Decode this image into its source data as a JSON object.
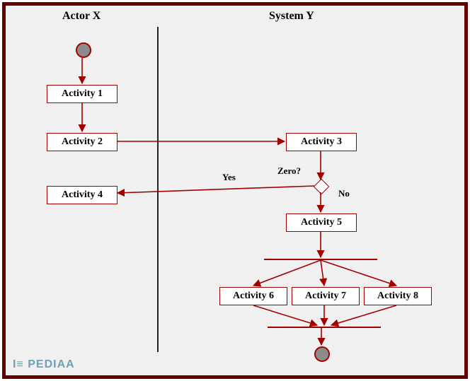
{
  "lanes": {
    "actor": "Actor X",
    "system": "System Y"
  },
  "activities": {
    "a1": "Activity 1",
    "a2": "Activity 2",
    "a3": "Activity 3",
    "a4": "Activity 4",
    "a5": "Activity 5",
    "a6": "Activity 6",
    "a7": "Activity 7",
    "a8": "Activity 8"
  },
  "decision": {
    "question": "Zero?",
    "yes": "Yes",
    "no": "No"
  },
  "watermark": "I≡ PEDIAA",
  "colors": {
    "frame": "#660000",
    "stroke": "#a00000",
    "nodeFill": "#8c8c8c",
    "bg": "#f0f0f0"
  }
}
